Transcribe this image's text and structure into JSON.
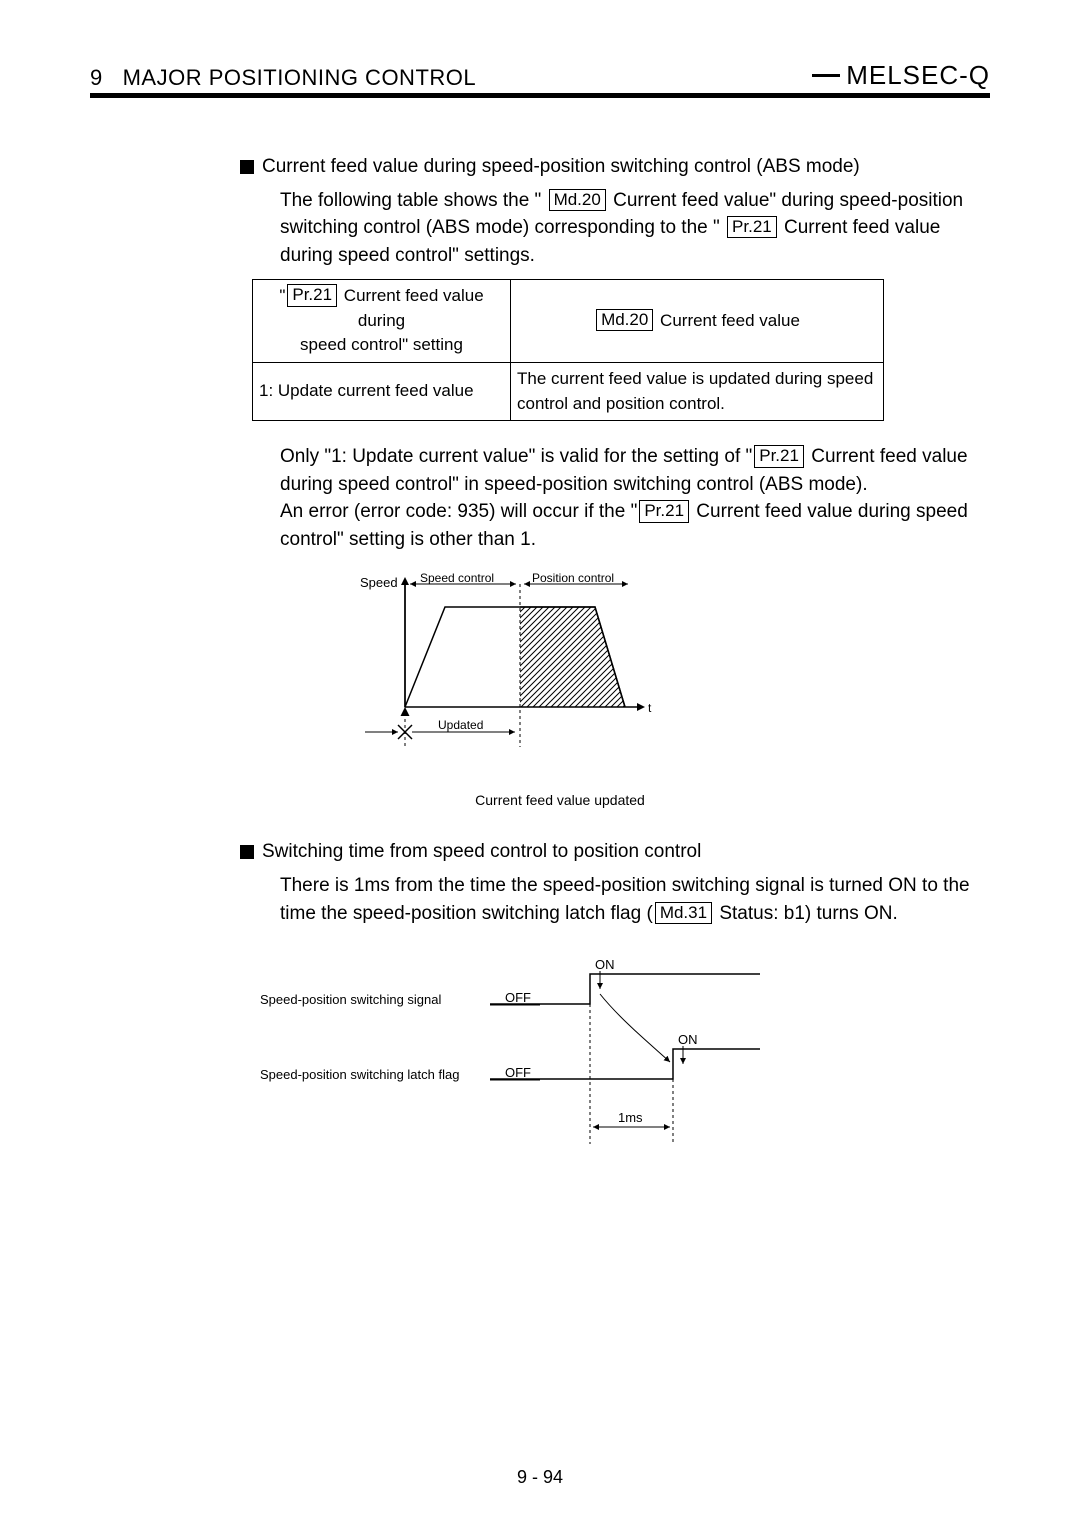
{
  "header": {
    "chapter_num": "9",
    "chapter_title": "MAJOR POSITIONING CONTROL",
    "series": "MELSEC-Q"
  },
  "section1": {
    "title": "Current feed value during speed-position switching control (ABS mode)",
    "intro_a": "The following table shows the \"",
    "intro_box1": "Md.20",
    "intro_b": " Current feed value\" during speed-position switching control (ABS mode) corresponding to the \"",
    "intro_box2": "Pr.21",
    "intro_c": " Current feed value during speed control\" settings."
  },
  "table": {
    "h1_prefix": "\"",
    "h1_box": "Pr.21",
    "h1_suffix1": " Current feed value during",
    "h1_suffix2": "speed control\" setting",
    "h2_box": "Md.20",
    "h2_suffix": " Current feed value",
    "r1c1": "1: Update current feed value",
    "r1c2": "The current feed value is updated during speed control and position control."
  },
  "after_table": {
    "p1_a": "Only \"1: Update current value\" is valid for the setting of \"",
    "p1_box": "Pr.21",
    "p1_b": " Current feed value during speed control\" in speed-position switching control (ABS mode).",
    "p2_a": "An error (error code: 935) will occur if the \"",
    "p2_box": "Pr.21",
    "p2_b": " Current feed value during speed control\" setting is other than 1."
  },
  "diagram1": {
    "yaxis": "Speed",
    "label_speed": "Speed control",
    "label_position": "Position control",
    "label_updated": "Updated",
    "label_t": "t",
    "caption": "Current feed value updated"
  },
  "section2": {
    "title": "Switching time from speed control to position control",
    "p_a": "There is 1ms from the time the speed-position switching signal is turned ON to the time the speed-position switching latch flag (",
    "p_box": "Md.31",
    "p_b": " Status: b1) turns ON."
  },
  "diagram2": {
    "row1_label": "Speed-position switching signal",
    "row2_label": "Speed-position switching latch flag",
    "off": "OFF",
    "on": "ON",
    "delay": "1ms"
  },
  "page_number": "9 - 94"
}
